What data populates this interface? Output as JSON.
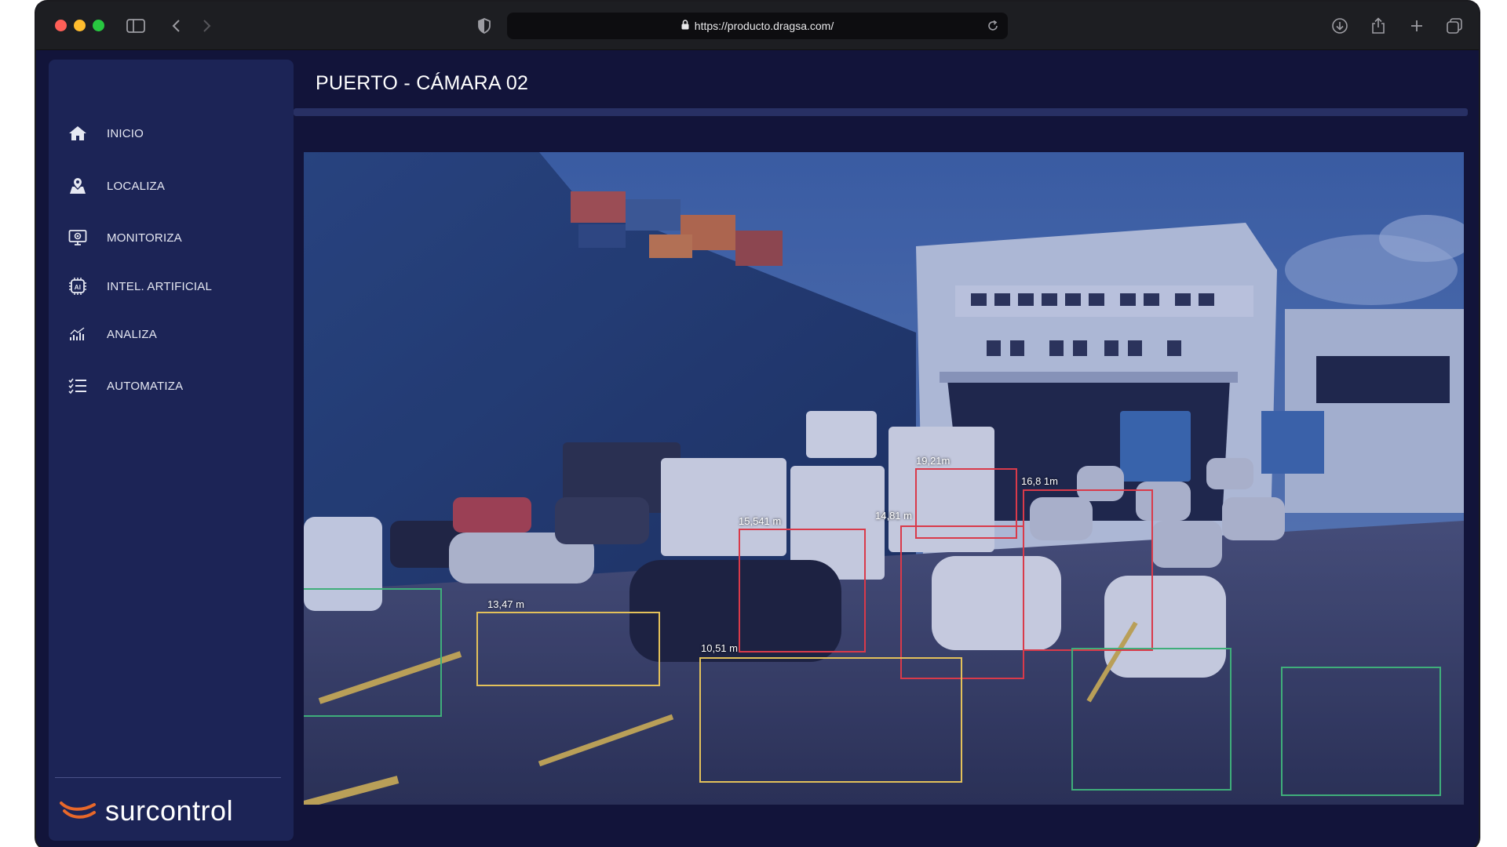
{
  "browser": {
    "url": "https://producto.dragsa.com/"
  },
  "sidebar": {
    "items": [
      {
        "label": "INICIO",
        "icon": "home-icon"
      },
      {
        "label": "LOCALIZA",
        "icon": "map-pin-icon"
      },
      {
        "label": "MONITORIZA",
        "icon": "monitor-icon"
      },
      {
        "label": "INTEL. ARTIFICIAL",
        "icon": "ai-chip-icon"
      },
      {
        "label": "ANALIZA",
        "icon": "chart-icon"
      },
      {
        "label": "AUTOMATIZA",
        "icon": "checklist-icon"
      }
    ],
    "brand": "surcontrol",
    "brand_color": "#e8682a"
  },
  "main": {
    "title": "PUERTO - CÁMARA 02",
    "detections": [
      {
        "label": "19,21m",
        "color": "#d93a4a"
      },
      {
        "label": "16,8 1m",
        "color": "#d93a4a"
      },
      {
        "label": "15,541 m",
        "color": "#d93a4a"
      },
      {
        "label": "14,81 m",
        "color": "#d93a4a"
      },
      {
        "label": "13,47 m",
        "color": "#e3c15a"
      },
      {
        "label": "10,51 m",
        "color": "#e3c15a"
      },
      {
        "label": "",
        "color": "#3fae7a"
      },
      {
        "label": "",
        "color": "#3fae7a"
      },
      {
        "label": "",
        "color": "#3fae7a"
      }
    ]
  },
  "colors": {
    "sidebar_bg": "#1c2456",
    "page_bg": "#12143a",
    "alert": "#d93a4a",
    "warning": "#e3c15a",
    "ok": "#3fae7a"
  }
}
